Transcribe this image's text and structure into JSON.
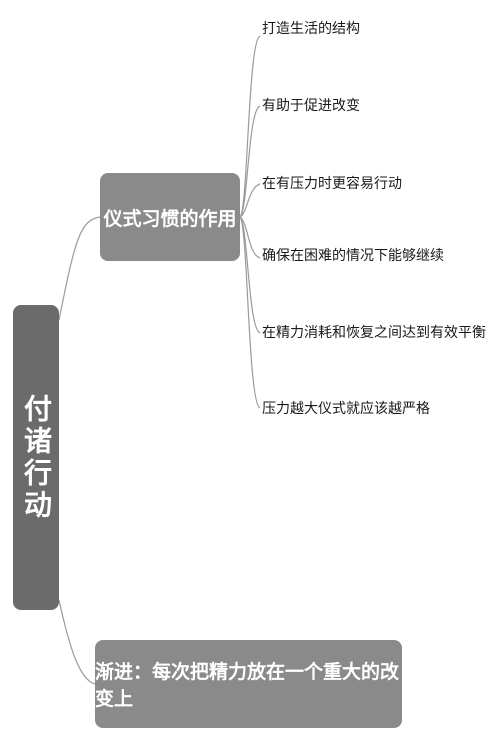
{
  "root": {
    "label": "付诸行动"
  },
  "branches": [
    {
      "label": "仪式习惯的作用",
      "children": [
        "打造生活的结构",
        "有助于促进改变",
        "在有压力时更容易行动",
        "确保在困难的情况下能够继续",
        "在精力消耗和恢复之间达到有效平衡",
        "压力越大仪式就应该越严格"
      ]
    },
    {
      "label": "渐进：每次把精力放在一个重大的改变上",
      "children": []
    }
  ],
  "colors": {
    "root_fill": "#6b6b6b",
    "branch_fill": "#8a8a8a",
    "connector": "#9a9a9a",
    "text_on_node": "#ffffff",
    "leaf_text": "#1a1a1a"
  }
}
